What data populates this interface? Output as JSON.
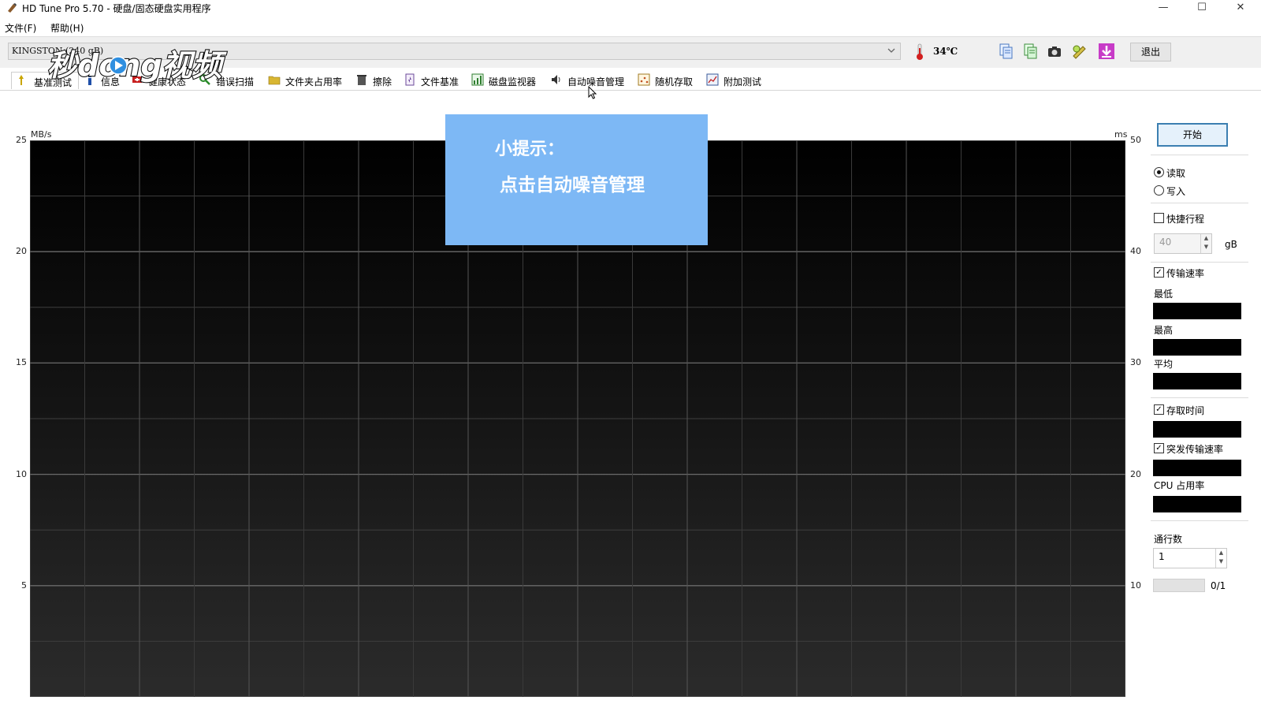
{
  "window": {
    "title": "HD Tune Pro 5.70 - 硬盘/固态硬盘实用程序",
    "controls": {
      "minimize": "—",
      "maximize": "☐",
      "close": "✕"
    }
  },
  "menu": [
    {
      "label": "文件(F)"
    },
    {
      "label": "帮助(H)"
    }
  ],
  "toolbar": {
    "drive_select": "KINGSTON (240 gB)",
    "temperature": "34℃",
    "exit_label": "退出",
    "icons": [
      "copy-info-icon",
      "copy-all-icon",
      "screenshot-icon",
      "options-icon",
      "save-icon"
    ]
  },
  "watermark": {
    "text": "秒dong视频"
  },
  "tabs": [
    {
      "label": "基准测试",
      "icon": "benchmark-icon"
    },
    {
      "label": "信息",
      "icon": "info-icon"
    },
    {
      "label": "健康状态",
      "icon": "health-icon"
    },
    {
      "label": "错误扫描",
      "icon": "error-scan-icon"
    },
    {
      "label": "文件夹占用率",
      "icon": "folder-usage-icon"
    },
    {
      "label": "擦除",
      "icon": "erase-icon"
    },
    {
      "label": "文件基准",
      "icon": "file-benchmark-icon"
    },
    {
      "label": "磁盘监视器",
      "icon": "disk-monitor-icon"
    },
    {
      "label": "自动噪音管理",
      "icon": "noise-management-icon"
    },
    {
      "label": "随机存取",
      "icon": "random-access-icon"
    },
    {
      "label": "附加测试",
      "icon": "extra-tests-icon"
    }
  ],
  "tip": {
    "title": "小提示：",
    "body": "点击自动噪音管理"
  },
  "chart_data": {
    "type": "line",
    "left_axis": {
      "unit": "MB/s",
      "ticks": [
        25,
        20,
        15,
        10,
        5
      ],
      "range": [
        0,
        25
      ]
    },
    "right_axis": {
      "unit": "ms",
      "ticks": [
        50,
        40,
        30,
        20,
        10
      ],
      "range": [
        0,
        50
      ]
    },
    "series": [],
    "grid": true
  },
  "panel": {
    "start_label": "开始",
    "mode_read": "读取",
    "mode_write": "写入",
    "mode_selected": "read",
    "short_stroke_label": "快捷行程",
    "short_stroke_checked": false,
    "short_stroke_value": "40",
    "short_stroke_unit": "gB",
    "transfer_rate_label": "传输速率",
    "transfer_rate_checked": true,
    "min_label": "最低",
    "max_label": "最高",
    "avg_label": "平均",
    "access_time_label": "存取时间",
    "access_time_checked": true,
    "burst_rate_label": "突发传输速率",
    "burst_rate_checked": true,
    "cpu_label": "CPU 占用率",
    "passes_label": "通行数",
    "passes_value": "1",
    "progress_text": "0/1",
    "progress_fraction": 0
  }
}
